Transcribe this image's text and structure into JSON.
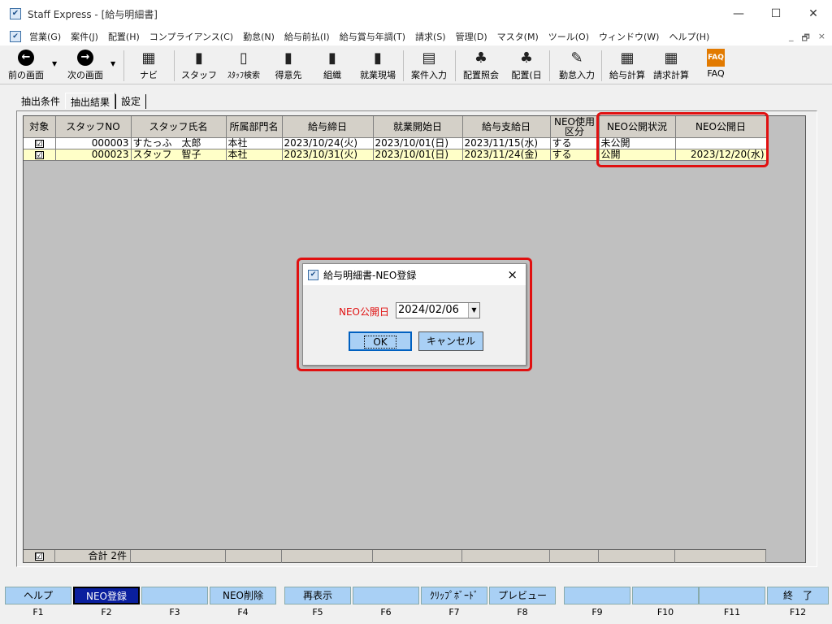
{
  "window": {
    "title": "Staff Express - [給与明細書]",
    "controls": [
      "—",
      "☐",
      "✕"
    ]
  },
  "menubar": {
    "items": [
      "営業(G)",
      "案件(J)",
      "配置(H)",
      "コンプライアンス(C)",
      "勤怠(N)",
      "給与前払(I)",
      "給与賞与年調(T)",
      "請求(S)",
      "管理(D)",
      "マスタ(M)",
      "ツール(O)",
      "ウィンドウ(W)",
      "ヘルプ(H)"
    ],
    "mdi_controls": [
      "_",
      "🗗",
      "×"
    ]
  },
  "toolbar": {
    "buttons": [
      {
        "label": "前の画面",
        "icon": "back-arrow-icon"
      },
      {
        "label": "次の画面",
        "icon": "forward-arrow-icon"
      },
      {
        "label": "ナビ",
        "icon": "navi-icon"
      },
      {
        "label": "スタッフ",
        "icon": "staff-icon"
      },
      {
        "label": "ｽﾀｯﾌ検索",
        "icon": "staff-search-icon"
      },
      {
        "label": "得意先",
        "icon": "customer-icon"
      },
      {
        "label": "組織",
        "icon": "organization-icon"
      },
      {
        "label": "就業現場",
        "icon": "worksite-icon"
      },
      {
        "label": "案件入力",
        "icon": "job-entry-icon"
      },
      {
        "label": "配置照会",
        "icon": "placement-inquiry-icon"
      },
      {
        "label": "配置(日",
        "icon": "placement-day-icon"
      },
      {
        "label": "勤怠入力",
        "icon": "attendance-entry-icon"
      },
      {
        "label": "給与計算",
        "icon": "payroll-calc-icon"
      },
      {
        "label": "請求計算",
        "icon": "billing-calc-icon"
      },
      {
        "label": "FAQ",
        "icon": "faq-icon"
      }
    ]
  },
  "tabs": [
    "抽出条件",
    "抽出結果",
    "設定"
  ],
  "grid": {
    "headers": [
      "対象",
      "スタッフNO",
      "スタッフ氏名",
      "所属部門名",
      "給与締日",
      "就業開始日",
      "給与支給日",
      "NEO使用区分",
      "NEO公開状況",
      "NEO公開日"
    ],
    "rows": [
      {
        "checked": "☑",
        "staff_no": "000003",
        "name": "すたっふ　太郎",
        "dept": "本社",
        "close": "2023/10/24(火)",
        "start": "2023/10/01(日)",
        "pay": "2023/11/15(水)",
        "use": "する",
        "status": "未公開",
        "pub_date": ""
      },
      {
        "checked": "☑",
        "staff_no": "000023",
        "name": "スタッフ　智子",
        "dept": "本社",
        "close": "2023/10/31(火)",
        "start": "2023/10/01(日)",
        "pay": "2023/11/24(金)",
        "use": "する",
        "status": "公開",
        "pub_date": "2023/12/20(水)"
      }
    ],
    "footer_check": "☑",
    "footer_total": "合計 2件"
  },
  "dialog": {
    "title": "給与明細書-NEO登録",
    "label": "NEO公開日",
    "date_value": "2024/02/06",
    "ok": "OK",
    "cancel": "キャンセル",
    "close": "×"
  },
  "fkeys": [
    {
      "label": "ヘルプ",
      "key": "F1"
    },
    {
      "label": "NEO登録",
      "key": "F2"
    },
    {
      "label": "",
      "key": "F3"
    },
    {
      "label": "NEO削除",
      "key": "F4"
    },
    {
      "label": "再表示",
      "key": "F5"
    },
    {
      "label": "",
      "key": "F6"
    },
    {
      "label": "ｸﾘｯﾌﾟﾎﾞｰﾄﾞ",
      "key": "F7"
    },
    {
      "label": "プレビュー",
      "key": "F8"
    },
    {
      "label": "",
      "key": "F9"
    },
    {
      "label": "",
      "key": "F10"
    },
    {
      "label": "",
      "key": "F11"
    },
    {
      "label": "終　了",
      "key": "F12"
    }
  ],
  "colors": {
    "highlight": "#e01010",
    "button_blue": "#a9d0f5",
    "row_yellow": "#ffffc8",
    "active_fkey": "#0a1f9e"
  }
}
